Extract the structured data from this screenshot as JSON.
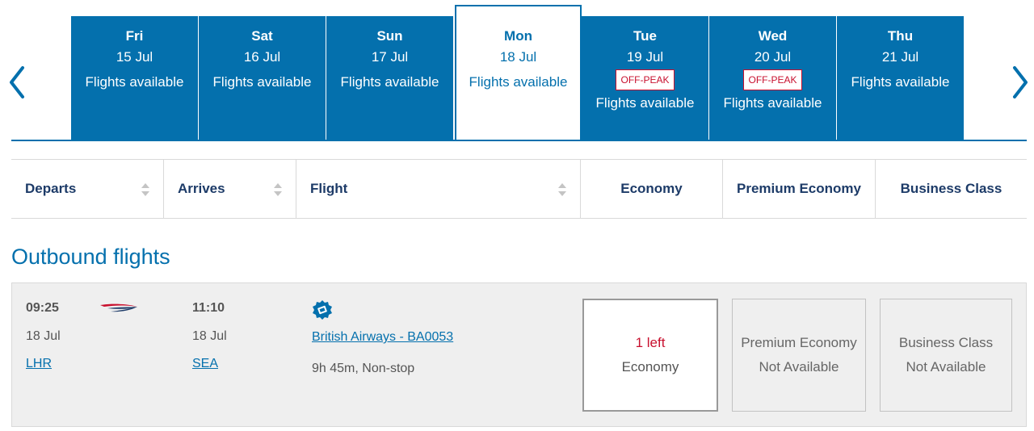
{
  "colors": {
    "brand_blue": "#0470ad",
    "header_navy": "#1d3b68",
    "offpeak_red": "#c8102e",
    "row_bg": "#efefef"
  },
  "nav": {
    "prev_icon": "chevron-left-icon",
    "next_icon": "chevron-right-icon"
  },
  "dates": [
    {
      "dow": "Fri",
      "dm": "15 Jul",
      "avail": "Flights available",
      "offpeak": ""
    },
    {
      "dow": "Sat",
      "dm": "16 Jul",
      "avail": "Flights available",
      "offpeak": ""
    },
    {
      "dow": "Sun",
      "dm": "17 Jul",
      "avail": "Flights available",
      "offpeak": ""
    },
    {
      "dow": "Mon",
      "dm": "18 Jul",
      "avail": "Flights available",
      "offpeak": "",
      "selected": true
    },
    {
      "dow": "Tue",
      "dm": "19 Jul",
      "avail": "Flights available",
      "offpeak": "OFF-PEAK"
    },
    {
      "dow": "Wed",
      "dm": "20 Jul",
      "avail": "Flights available",
      "offpeak": "OFF-PEAK"
    },
    {
      "dow": "Thu",
      "dm": "21 Jul",
      "avail": "Flights available",
      "offpeak": ""
    }
  ],
  "headers": {
    "departs": "Departs",
    "arrives": "Arrives",
    "flight": "Flight",
    "economy": "Economy",
    "premium": "Premium Economy",
    "business": "Business Class"
  },
  "section_title": "Outbound flights",
  "flight": {
    "dep_time": "09:25",
    "dep_date": "18 Jul",
    "dep_code": "LHR",
    "arr_time": "11:10",
    "arr_date": "18 Jul",
    "arr_code": "SEA",
    "airline_logo": "british-airways-speedmarque",
    "link": "British Airways - BA0053",
    "duration": "9h 45m, Non-stop",
    "fares": {
      "economy": {
        "seats_left": "1 left",
        "class": "Economy"
      },
      "premium": {
        "class": "Premium Economy",
        "status": "Not Available"
      },
      "business": {
        "class": "Business Class",
        "status": "Not Available"
      }
    }
  }
}
